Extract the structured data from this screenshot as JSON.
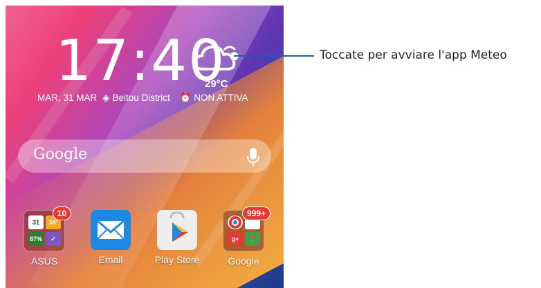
{
  "clock": {
    "time": "17:40"
  },
  "weather": {
    "temperature": "29°C",
    "icon": "cloud-icon"
  },
  "status_line": {
    "date": "MAR, 31 MAR",
    "location": "Beitou District",
    "alarm": "NON ATTIVA"
  },
  "search": {
    "brand": "Google",
    "mic_icon": "mic-icon"
  },
  "apps": [
    {
      "label": "ASUS",
      "badge": "10",
      "mini": [
        "31",
        "34°",
        "87%",
        "✓"
      ]
    },
    {
      "label": "Email"
    },
    {
      "label": "Play Store"
    },
    {
      "label": "Google",
      "badge": "999+"
    }
  ],
  "callout": {
    "text": "Toccate per avviare l'app Meteo"
  }
}
